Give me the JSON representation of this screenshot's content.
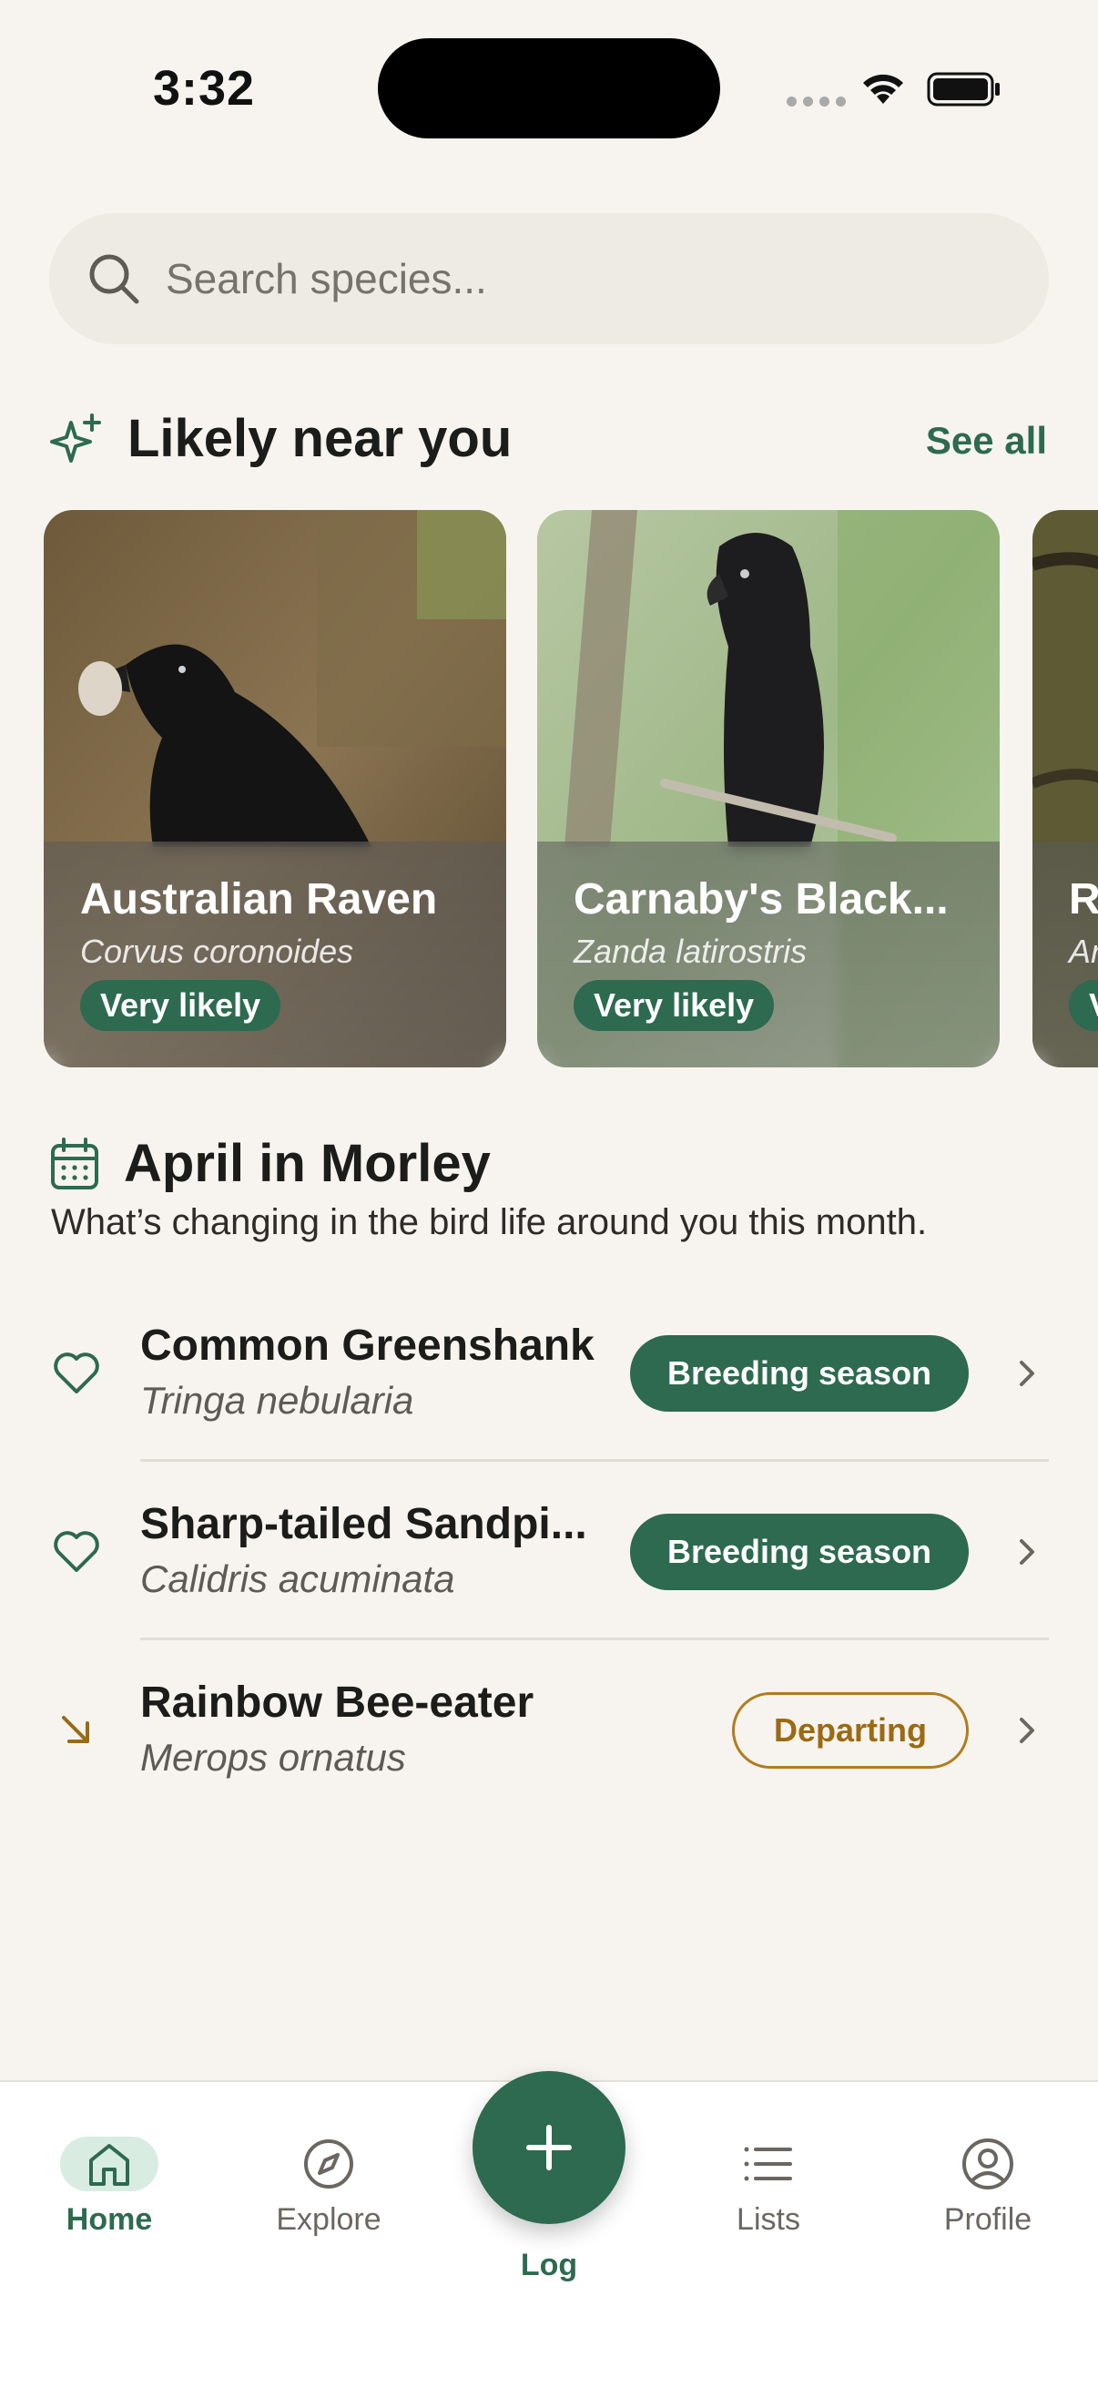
{
  "status_bar": {
    "time": "3:32"
  },
  "search": {
    "placeholder": "Search species..."
  },
  "likely": {
    "title": "Likely near you",
    "see_all": "See all",
    "cards": [
      {
        "name": "Australian Raven",
        "scientific": "Corvus coronoides",
        "badge": "Very likely"
      },
      {
        "name": "Carnaby's Black...",
        "scientific": "Zanda latirostris",
        "badge": "Very likely"
      },
      {
        "name": "R",
        "scientific": "Ar",
        "badge": "V"
      }
    ]
  },
  "month": {
    "title": "April in Morley",
    "subtitle": "What’s changing in the bird life around you this month.",
    "rows": [
      {
        "icon": "heart-icon",
        "name": "Common Greenshank",
        "scientific": "Tringa nebularia",
        "status": "Breeding season"
      },
      {
        "icon": "heart-icon",
        "name": "Sharp-tailed Sandpi...",
        "scientific": "Calidris acuminata",
        "status": "Breeding season"
      },
      {
        "icon": "arrow-down-right-icon",
        "name": "Rainbow Bee-eater",
        "scientific": "Merops ornatus",
        "status": "Departing"
      }
    ]
  },
  "nav": {
    "home": "Home",
    "explore": "Explore",
    "log": "Log",
    "lists": "Lists",
    "profile": "Profile",
    "active": "home"
  },
  "colors": {
    "accent": "#2d6a4f",
    "departing": "#9b6a12",
    "background": "#f7f4ef"
  }
}
